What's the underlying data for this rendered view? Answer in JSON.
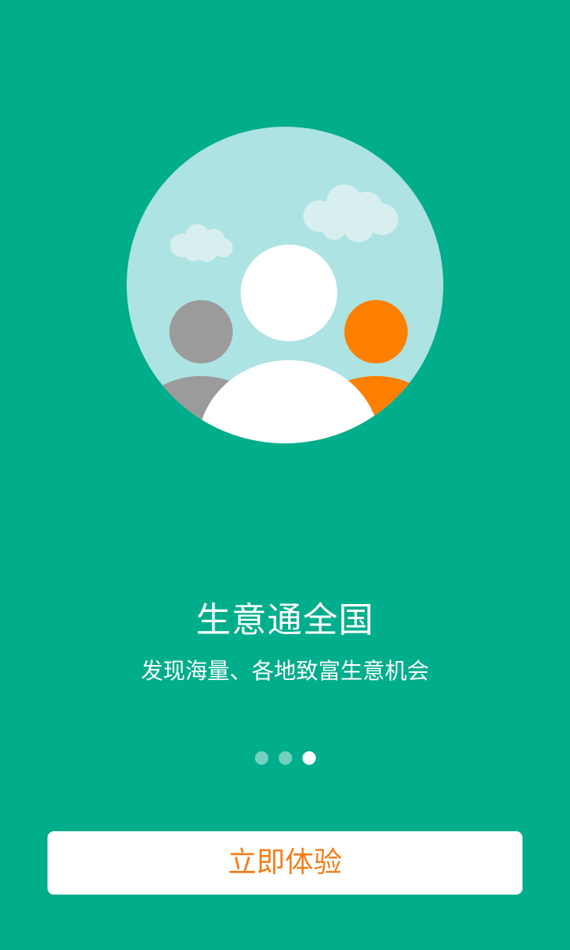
{
  "hero": {
    "illustration": "people-group-illustration",
    "colors": {
      "sky": "#ade3e3",
      "cloud": "#d8eff0",
      "person_center": "#ffffff",
      "person_left": "#9b9b9b",
      "person_right": "#ff7f00"
    }
  },
  "title": "生意通全国",
  "subtitle": "发现海量、各地致富生意机会",
  "pagination": {
    "total": 3,
    "active_index": 2
  },
  "cta": {
    "label": "立即体验",
    "text_color": "#f27e1c"
  },
  "colors": {
    "background": "#00ae8b"
  }
}
